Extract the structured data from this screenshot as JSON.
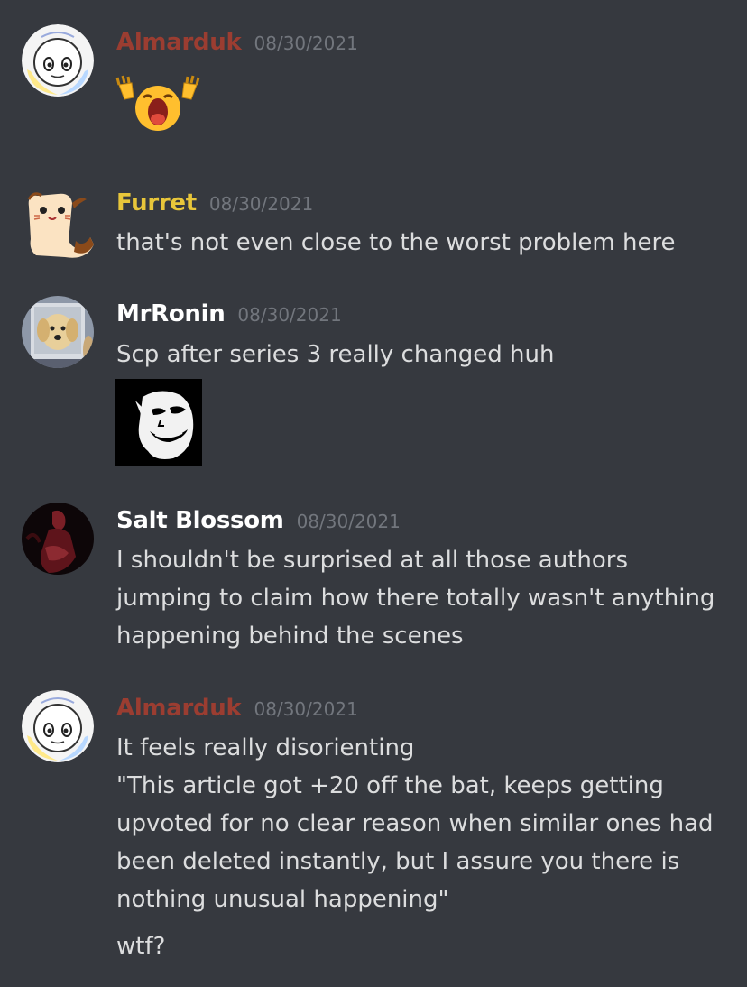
{
  "messages": [
    {
      "username": "Almarduk",
      "timestamp": "08/30/2021",
      "user_color": "#9b3d31",
      "lines": [],
      "emoji": "scream-hands-emoji",
      "avatar": "white-round-face-avatar"
    },
    {
      "username": "Furret",
      "timestamp": "08/30/2021",
      "user_color": "#e8c63a",
      "lines": [
        "that's not even close to the worst problem here"
      ],
      "avatar": "furret-avatar"
    },
    {
      "username": "MrRonin",
      "timestamp": "08/30/2021",
      "user_color": "#ffffff",
      "lines": [
        "Scp after series 3 really changed huh"
      ],
      "attachment": "trollface-dark-image",
      "avatar": "dog-photo-avatar"
    },
    {
      "username": "Salt Blossom",
      "timestamp": "08/30/2021",
      "user_color": "#ffffff",
      "lines": [
        "I shouldn't be surprised at all those authors",
        "jumping to claim how there totally wasn't anything",
        "happening behind the scenes"
      ],
      "avatar": "dark-red-figure-avatar"
    },
    {
      "username": "Almarduk",
      "timestamp": "08/30/2021",
      "user_color": "#9b3d31",
      "lines": [
        "It feels really disorienting",
        "\"This article got +20 off the bat, keeps getting",
        "upvoted for no clear reason when similar ones had",
        "been deleted instantly, but I assure you there is",
        "nothing unusual happening\""
      ],
      "followup": "wtf?",
      "avatar": "white-round-face-avatar"
    }
  ]
}
